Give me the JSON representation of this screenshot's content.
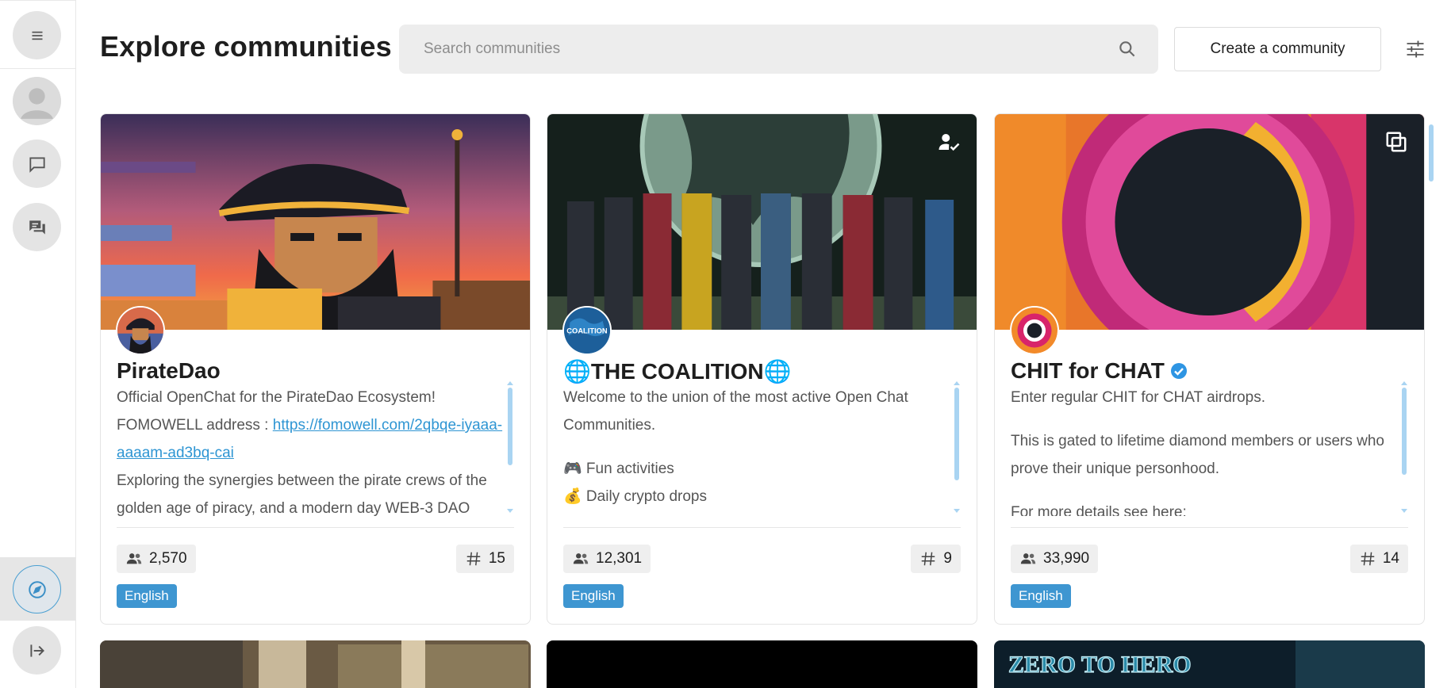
{
  "header": {
    "title": "Explore communities",
    "search_placeholder": "Search communities",
    "create_label": "Create a community"
  },
  "sidebar": {
    "items": [
      {
        "name": "menu"
      },
      {
        "name": "profile"
      },
      {
        "name": "direct-chats"
      },
      {
        "name": "group-chats"
      },
      {
        "name": "explore",
        "active": true
      },
      {
        "name": "logout"
      }
    ]
  },
  "communities": [
    {
      "name": "PirateDao",
      "desc_1": "Official OpenChat for the PirateDao Ecosystem!",
      "desc_2_prefix": "FOMOWELL address : ",
      "desc_2_link": "https://fomowell.com/2qbqe-iyaaa-aaaam-ad3bq-cai",
      "desc_3": "Exploring the synergies between the pirate crews of the golden age of piracy, and a modern day WEB-3 DAO",
      "members": "2,570",
      "channels": "15",
      "language": "English"
    },
    {
      "name": "🌐THE COALITION🌐",
      "desc_1": "Welcome to the union of the most active Open Chat Communities.",
      "desc_2": "🎮 Fun activities",
      "desc_3": "💰 Daily crypto drops",
      "avatar_text": "COALITION",
      "members": "12,301",
      "channels": "9",
      "language": "English"
    },
    {
      "name": "CHIT for CHAT",
      "verified": true,
      "desc_1": "Enter regular CHIT for CHAT airdrops.",
      "desc_2": "This is gated to lifetime diamond members or users who prove their unique personhood.",
      "desc_3": "For more details see here:",
      "members": "33,990",
      "channels": "14",
      "language": "English"
    }
  ],
  "next_row": {
    "third_banner_text": "ZERO TO HERO"
  },
  "colors": {
    "accent": "#3e96d1",
    "link": "#2e95d3",
    "scrollbar": "#a9d4f2"
  }
}
